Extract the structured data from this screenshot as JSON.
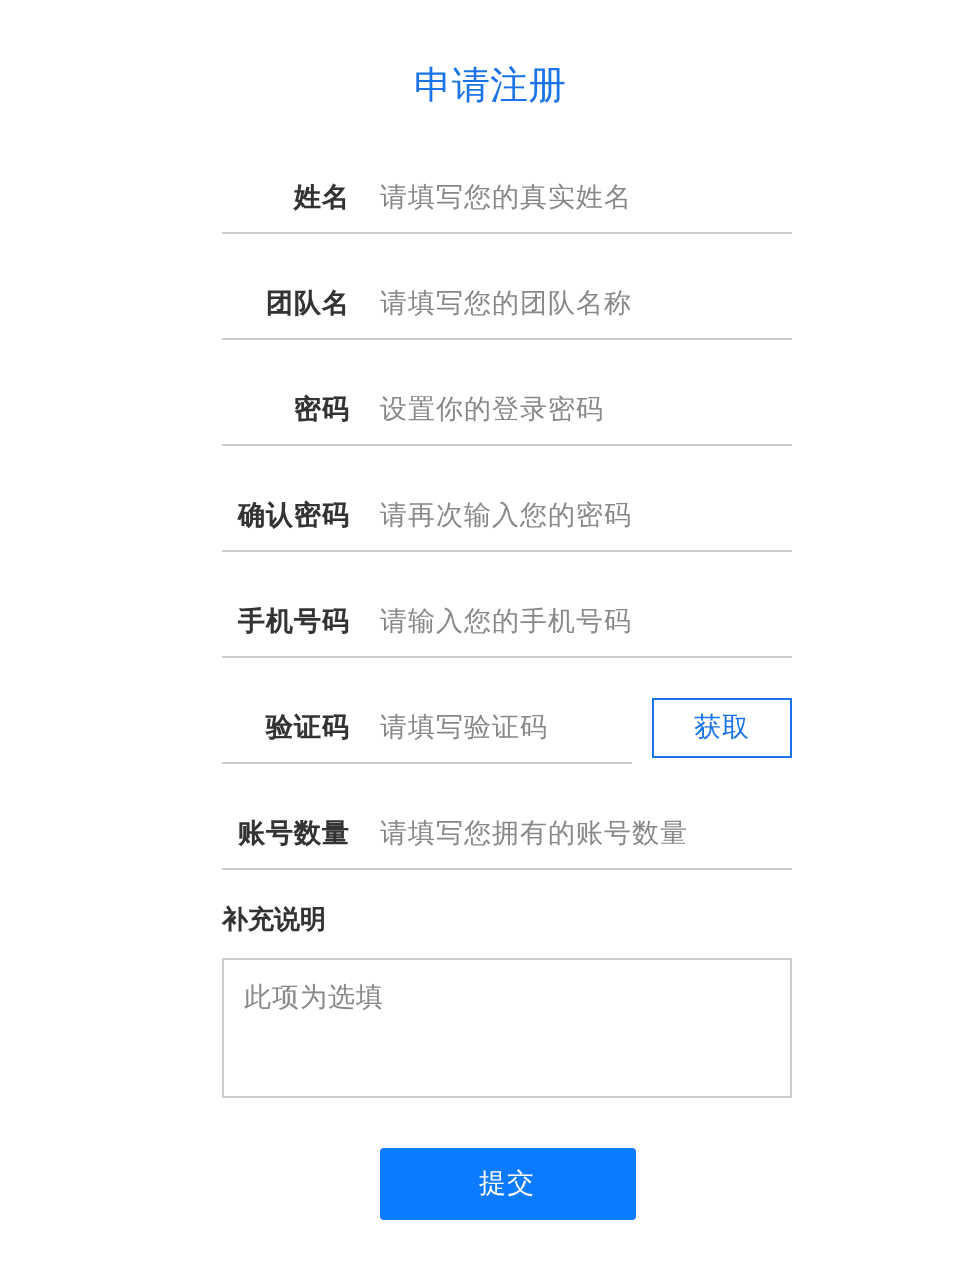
{
  "title": "申请注册",
  "fields": [
    {
      "label": "姓名",
      "placeholder": "请填写您的真实姓名",
      "kind": "text"
    },
    {
      "label": "团队名",
      "placeholder": "请填写您的团队名称",
      "kind": "text"
    },
    {
      "label": "密码",
      "placeholder": "设置你的登录密码",
      "kind": "password"
    },
    {
      "label": "确认密码",
      "placeholder": "请再次输入您的密码",
      "kind": "password"
    },
    {
      "label": "手机号码",
      "placeholder": "请输入您的手机号码",
      "kind": "text"
    },
    {
      "label": "验证码",
      "placeholder": "请填写验证码",
      "kind": "code",
      "button": "获取"
    },
    {
      "label": "账号数量",
      "placeholder": "请填写您拥有的账号数量",
      "kind": "text"
    }
  ],
  "notes": {
    "label": "补充说明",
    "placeholder": "此项为选填"
  },
  "submit": "提交"
}
